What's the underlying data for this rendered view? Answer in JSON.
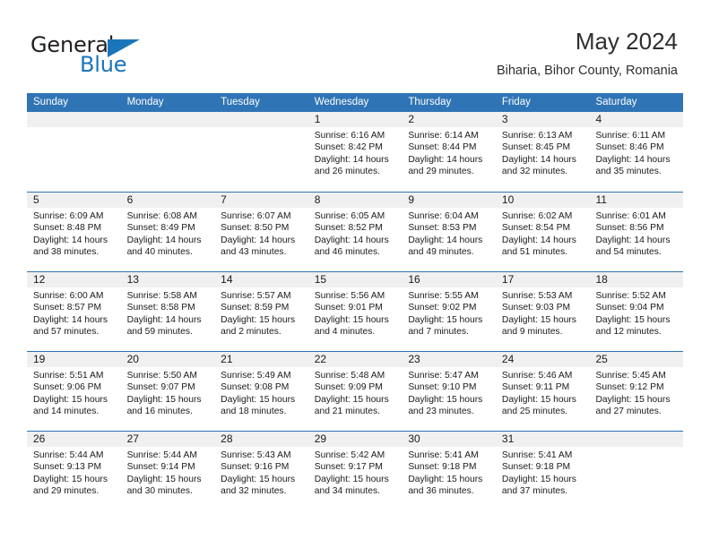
{
  "brand": {
    "name_part1": "General",
    "name_part2": "Blue",
    "color_dark": "#231f20",
    "color_blue": "#1b75bb"
  },
  "header": {
    "title": "May 2024",
    "subtitle": "Biharia, Bihor County, Romania"
  },
  "theme": {
    "header_bg": "#2f74b5",
    "header_text": "#ffffff",
    "day_band_bg": "#f0f0f0",
    "cell_bg": "#ffffff",
    "rule_color": "#2f74b5"
  },
  "weekdays": [
    "Sunday",
    "Monday",
    "Tuesday",
    "Wednesday",
    "Thursday",
    "Friday",
    "Saturday"
  ],
  "labels": {
    "sunrise_prefix": "Sunrise: ",
    "sunset_prefix": "Sunset: ",
    "daylight_prefix": "Daylight: "
  },
  "weeks": [
    [
      {
        "day": "",
        "empty": true
      },
      {
        "day": "",
        "empty": true
      },
      {
        "day": "",
        "empty": true
      },
      {
        "day": "1",
        "sunrise": "Sunrise: 6:16 AM",
        "sunset": "Sunset: 8:42 PM",
        "daylight1": "Daylight: 14 hours",
        "daylight2": "and 26 minutes."
      },
      {
        "day": "2",
        "sunrise": "Sunrise: 6:14 AM",
        "sunset": "Sunset: 8:44 PM",
        "daylight1": "Daylight: 14 hours",
        "daylight2": "and 29 minutes."
      },
      {
        "day": "3",
        "sunrise": "Sunrise: 6:13 AM",
        "sunset": "Sunset: 8:45 PM",
        "daylight1": "Daylight: 14 hours",
        "daylight2": "and 32 minutes."
      },
      {
        "day": "4",
        "sunrise": "Sunrise: 6:11 AM",
        "sunset": "Sunset: 8:46 PM",
        "daylight1": "Daylight: 14 hours",
        "daylight2": "and 35 minutes."
      }
    ],
    [
      {
        "day": "5",
        "sunrise": "Sunrise: 6:09 AM",
        "sunset": "Sunset: 8:48 PM",
        "daylight1": "Daylight: 14 hours",
        "daylight2": "and 38 minutes."
      },
      {
        "day": "6",
        "sunrise": "Sunrise: 6:08 AM",
        "sunset": "Sunset: 8:49 PM",
        "daylight1": "Daylight: 14 hours",
        "daylight2": "and 40 minutes."
      },
      {
        "day": "7",
        "sunrise": "Sunrise: 6:07 AM",
        "sunset": "Sunset: 8:50 PM",
        "daylight1": "Daylight: 14 hours",
        "daylight2": "and 43 minutes."
      },
      {
        "day": "8",
        "sunrise": "Sunrise: 6:05 AM",
        "sunset": "Sunset: 8:52 PM",
        "daylight1": "Daylight: 14 hours",
        "daylight2": "and 46 minutes."
      },
      {
        "day": "9",
        "sunrise": "Sunrise: 6:04 AM",
        "sunset": "Sunset: 8:53 PM",
        "daylight1": "Daylight: 14 hours",
        "daylight2": "and 49 minutes."
      },
      {
        "day": "10",
        "sunrise": "Sunrise: 6:02 AM",
        "sunset": "Sunset: 8:54 PM",
        "daylight1": "Daylight: 14 hours",
        "daylight2": "and 51 minutes."
      },
      {
        "day": "11",
        "sunrise": "Sunrise: 6:01 AM",
        "sunset": "Sunset: 8:56 PM",
        "daylight1": "Daylight: 14 hours",
        "daylight2": "and 54 minutes."
      }
    ],
    [
      {
        "day": "12",
        "sunrise": "Sunrise: 6:00 AM",
        "sunset": "Sunset: 8:57 PM",
        "daylight1": "Daylight: 14 hours",
        "daylight2": "and 57 minutes."
      },
      {
        "day": "13",
        "sunrise": "Sunrise: 5:58 AM",
        "sunset": "Sunset: 8:58 PM",
        "daylight1": "Daylight: 14 hours",
        "daylight2": "and 59 minutes."
      },
      {
        "day": "14",
        "sunrise": "Sunrise: 5:57 AM",
        "sunset": "Sunset: 8:59 PM",
        "daylight1": "Daylight: 15 hours",
        "daylight2": "and 2 minutes."
      },
      {
        "day": "15",
        "sunrise": "Sunrise: 5:56 AM",
        "sunset": "Sunset: 9:01 PM",
        "daylight1": "Daylight: 15 hours",
        "daylight2": "and 4 minutes."
      },
      {
        "day": "16",
        "sunrise": "Sunrise: 5:55 AM",
        "sunset": "Sunset: 9:02 PM",
        "daylight1": "Daylight: 15 hours",
        "daylight2": "and 7 minutes."
      },
      {
        "day": "17",
        "sunrise": "Sunrise: 5:53 AM",
        "sunset": "Sunset: 9:03 PM",
        "daylight1": "Daylight: 15 hours",
        "daylight2": "and 9 minutes."
      },
      {
        "day": "18",
        "sunrise": "Sunrise: 5:52 AM",
        "sunset": "Sunset: 9:04 PM",
        "daylight1": "Daylight: 15 hours",
        "daylight2": "and 12 minutes."
      }
    ],
    [
      {
        "day": "19",
        "sunrise": "Sunrise: 5:51 AM",
        "sunset": "Sunset: 9:06 PM",
        "daylight1": "Daylight: 15 hours",
        "daylight2": "and 14 minutes."
      },
      {
        "day": "20",
        "sunrise": "Sunrise: 5:50 AM",
        "sunset": "Sunset: 9:07 PM",
        "daylight1": "Daylight: 15 hours",
        "daylight2": "and 16 minutes."
      },
      {
        "day": "21",
        "sunrise": "Sunrise: 5:49 AM",
        "sunset": "Sunset: 9:08 PM",
        "daylight1": "Daylight: 15 hours",
        "daylight2": "and 18 minutes."
      },
      {
        "day": "22",
        "sunrise": "Sunrise: 5:48 AM",
        "sunset": "Sunset: 9:09 PM",
        "daylight1": "Daylight: 15 hours",
        "daylight2": "and 21 minutes."
      },
      {
        "day": "23",
        "sunrise": "Sunrise: 5:47 AM",
        "sunset": "Sunset: 9:10 PM",
        "daylight1": "Daylight: 15 hours",
        "daylight2": "and 23 minutes."
      },
      {
        "day": "24",
        "sunrise": "Sunrise: 5:46 AM",
        "sunset": "Sunset: 9:11 PM",
        "daylight1": "Daylight: 15 hours",
        "daylight2": "and 25 minutes."
      },
      {
        "day": "25",
        "sunrise": "Sunrise: 5:45 AM",
        "sunset": "Sunset: 9:12 PM",
        "daylight1": "Daylight: 15 hours",
        "daylight2": "and 27 minutes."
      }
    ],
    [
      {
        "day": "26",
        "sunrise": "Sunrise: 5:44 AM",
        "sunset": "Sunset: 9:13 PM",
        "daylight1": "Daylight: 15 hours",
        "daylight2": "and 29 minutes."
      },
      {
        "day": "27",
        "sunrise": "Sunrise: 5:44 AM",
        "sunset": "Sunset: 9:14 PM",
        "daylight1": "Daylight: 15 hours",
        "daylight2": "and 30 minutes."
      },
      {
        "day": "28",
        "sunrise": "Sunrise: 5:43 AM",
        "sunset": "Sunset: 9:16 PM",
        "daylight1": "Daylight: 15 hours",
        "daylight2": "and 32 minutes."
      },
      {
        "day": "29",
        "sunrise": "Sunrise: 5:42 AM",
        "sunset": "Sunset: 9:17 PM",
        "daylight1": "Daylight: 15 hours",
        "daylight2": "and 34 minutes."
      },
      {
        "day": "30",
        "sunrise": "Sunrise: 5:41 AM",
        "sunset": "Sunset: 9:18 PM",
        "daylight1": "Daylight: 15 hours",
        "daylight2": "and 36 minutes."
      },
      {
        "day": "31",
        "sunrise": "Sunrise: 5:41 AM",
        "sunset": "Sunset: 9:18 PM",
        "daylight1": "Daylight: 15 hours",
        "daylight2": "and 37 minutes."
      },
      {
        "day": "",
        "empty": true
      }
    ]
  ]
}
